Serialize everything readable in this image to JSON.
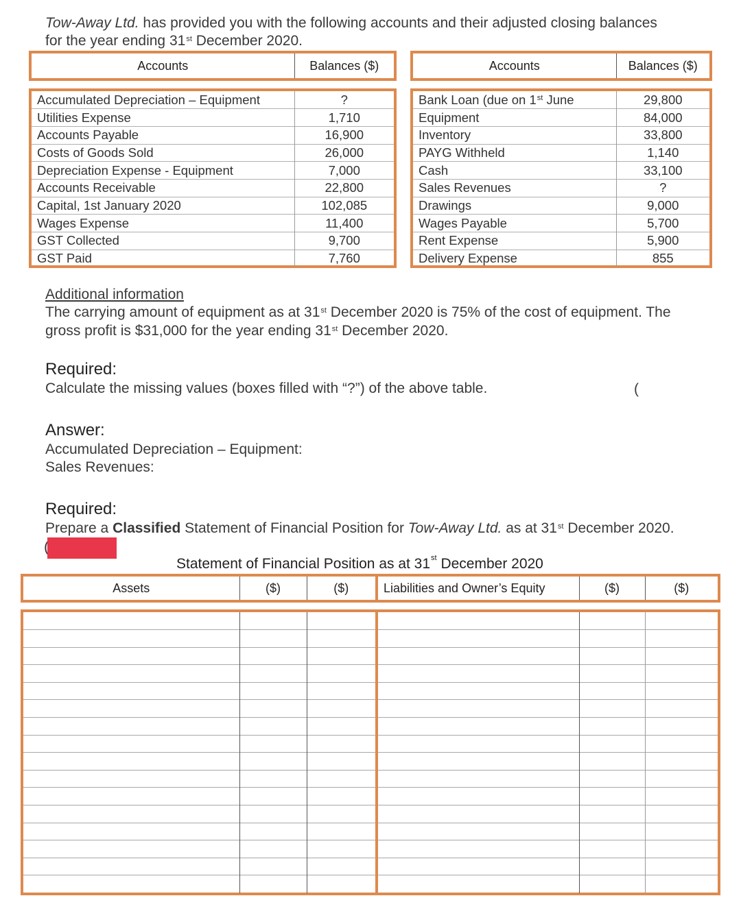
{
  "intro": {
    "company": "Tow-Away Ltd.",
    "line1_rest": " has provided you with the following accounts and their adjusted closing balances",
    "line2_pre": "for the year ending 31",
    "line2_sup": "st",
    "line2_post": " December 2020."
  },
  "accounts_table": {
    "header_account": "Accounts",
    "header_balance": "Balances ($)",
    "left": [
      {
        "account": "Accumulated Depreciation – Equipment",
        "balance": "?"
      },
      {
        "account": "Utilities Expense",
        "balance": "1,710"
      },
      {
        "account": "Accounts Payable",
        "balance": "16,900"
      },
      {
        "account": "Costs of Goods Sold",
        "balance": "26,000"
      },
      {
        "account": "Depreciation Expense - Equipment",
        "balance": "7,000"
      },
      {
        "account": "Accounts Receivable",
        "balance": "22,800"
      },
      {
        "account": "Capital, 1st January 2020",
        "balance": "102,085"
      },
      {
        "account": "Wages Expense",
        "balance": "11,400"
      },
      {
        "account": "GST Collected",
        "balance": "9,700"
      },
      {
        "account": "GST Paid",
        "balance": "7,760"
      }
    ],
    "right_first": {
      "pre": "Bank Loan (due on 1",
      "sup": "st",
      "post": " June",
      "balance": "29,800"
    },
    "right": [
      {
        "account": "Equipment",
        "balance": "84,000"
      },
      {
        "account": "Inventory",
        "balance": "33,800"
      },
      {
        "account": "PAYG Withheld",
        "balance": "1,140"
      },
      {
        "account": "Cash",
        "balance": "33,100"
      },
      {
        "account": "Sales Revenues",
        "balance": "?"
      },
      {
        "account": "Drawings",
        "balance": "9,000"
      },
      {
        "account": "Wages Payable",
        "balance": "5,700"
      },
      {
        "account": "Rent Expense",
        "balance": "5,900"
      },
      {
        "account": "Delivery Expense",
        "balance": "855"
      }
    ]
  },
  "additional_info": {
    "heading": "Additional information",
    "l1_pre": "The carrying amount of equipment as at 31",
    "l1_sup": "st",
    "l1_post": " December 2020 is 75% of the cost of equipment. The",
    "l2_pre": "gross profit is $31,000 for the year ending 31",
    "l2_sup": "st",
    "l2_post": " December 2020."
  },
  "required1": {
    "heading": "Required:",
    "text": "Calculate the missing values (boxes filled with “?”) of the above table.",
    "stray_paren": "("
  },
  "answer": {
    "heading": "Answer:",
    "acc_dep_label": "Accumulated Depreciation – Equipment:",
    "sales_label": "Sales Revenues:"
  },
  "required2": {
    "heading": "Required:",
    "pre": "Prepare a ",
    "bold": "Classified",
    "mid": " Statement of Financial Position for ",
    "company": "Tow-Away Ltd.",
    "post_pre": " as at 31",
    "sup": "st",
    "post": " December 2020.",
    "paren": "("
  },
  "sofp": {
    "title_pre": "Statement of Financial Position as at 31",
    "title_sup": "st",
    "title_post": " December 2020",
    "headers": [
      "Assets",
      "($)",
      "($)",
      "Liabilities and Owner’s Equity",
      "($)",
      "($)"
    ],
    "blank_rows": 16
  },
  "colors": {
    "border_orange": "#dd8a4e",
    "redaction_red": "#e8364a"
  }
}
